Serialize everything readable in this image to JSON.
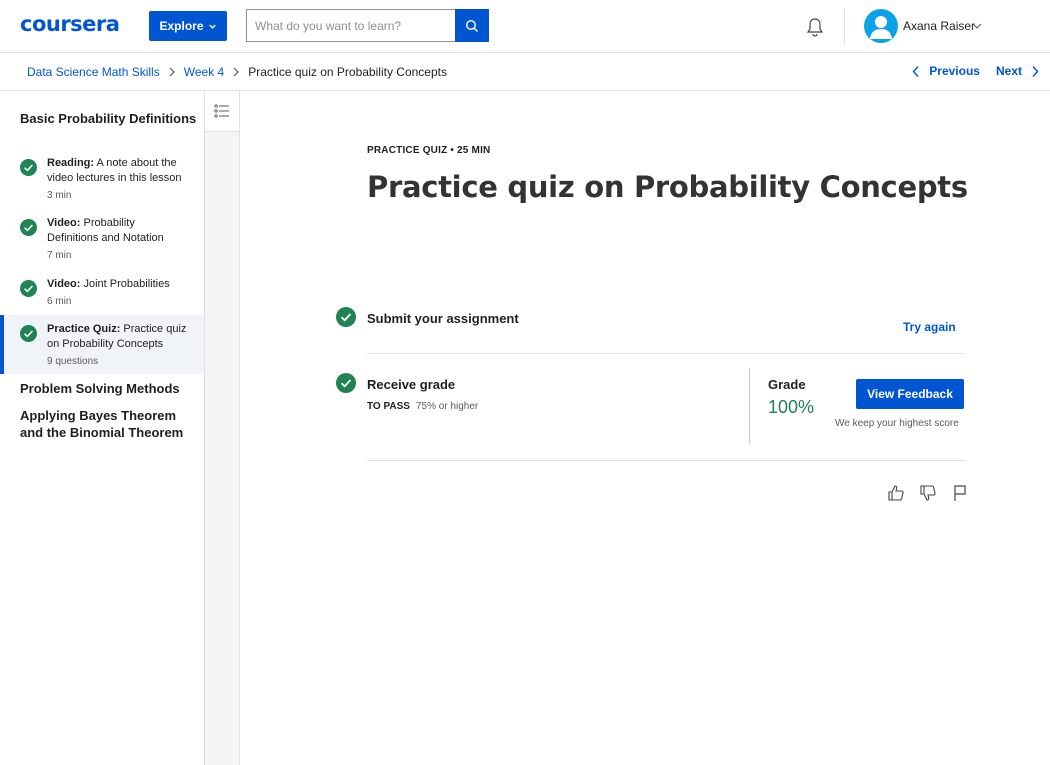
{
  "header": {
    "logo": "coursera",
    "explore_label": "Explore",
    "search_placeholder": "What do you want to learn?",
    "user_name": "Axana Raiser",
    "brand_color": "#0056d2"
  },
  "breadcrumb": {
    "items": [
      "Data Science Math Skills",
      "Week 4"
    ],
    "current": "Practice quiz on Probability Concepts",
    "previous_label": "Previous",
    "next_label": "Next"
  },
  "sidebar": {
    "sections": [
      {
        "title": "Basic Probability Definitions",
        "items": [
          {
            "type": "Reading:",
            "label": "A note about the video lectures in this lesson",
            "meta": "3 min",
            "completed": true
          },
          {
            "type": "Video:",
            "label": "Probability Definitions and Notation",
            "meta": "7 min",
            "completed": true
          },
          {
            "type": "Video:",
            "label": "Joint Probabilities",
            "meta": "6 min",
            "completed": true
          },
          {
            "type": "Practice Quiz:",
            "label": "Practice quiz on Probability Concepts",
            "meta": "9 questions",
            "completed": true,
            "active": true
          }
        ]
      },
      {
        "title": "Problem Solving Methods"
      },
      {
        "title": "Applying Bayes Theorem and the Binomial Theorem"
      }
    ]
  },
  "main": {
    "eyebrow": "PRACTICE QUIZ • 25 MIN",
    "title": "Practice quiz on Probability Concepts",
    "submit": {
      "title": "Submit your assignment",
      "action": "Try again"
    },
    "receive": {
      "title": "Receive grade",
      "to_pass_label": "TO PASS",
      "to_pass_value": "75% or higher",
      "grade_label": "Grade",
      "grade_value": "100%",
      "feedback_button": "View Feedback",
      "note": "We keep your highest score"
    },
    "success_color": "#1f8354"
  }
}
